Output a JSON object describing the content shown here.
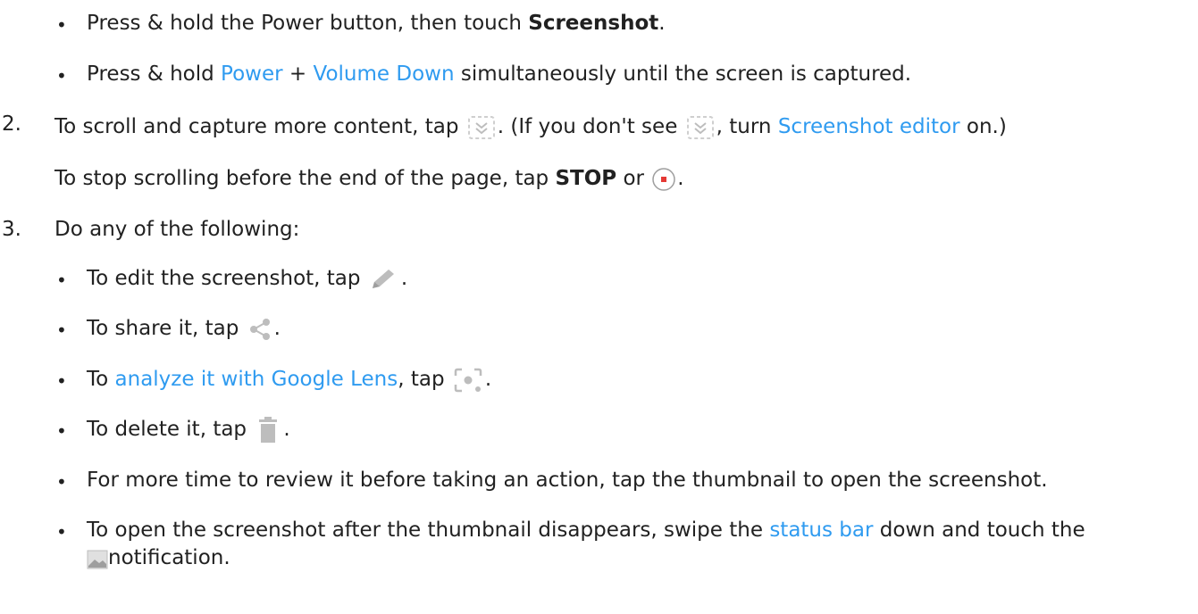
{
  "steps": {
    "bullet_power_menu": {
      "prefix": "Press & hold the Power button, then touch ",
      "bold": "Screenshot",
      "suffix": "."
    },
    "bullet_buttons": {
      "prefix": "Press & hold ",
      "link_power": "Power",
      "plus": " + ",
      "link_volume": "Volume Down",
      "suffix": " simultaneously until the screen is captured."
    },
    "step2": {
      "number": "2.",
      "part1": "To scroll and capture more content, tap ",
      "part2": ". (If you don't see ",
      "part3": ", turn ",
      "link_editor": "Screenshot editor",
      "part4": " on.)",
      "stop_prefix": "To stop scrolling before the end of the page, tap ",
      "stop_bold": "STOP",
      "stop_or": " or ",
      "stop_suffix": "."
    },
    "step3": {
      "number": "3.",
      "intro": "Do any of the following:",
      "edit_prefix": "To edit the screenshot, tap ",
      "edit_suffix": ".",
      "share_prefix": "To share it, tap ",
      "share_suffix": ".",
      "lens_prefix": "To ",
      "lens_link": "analyze it with Google Lens",
      "lens_mid": ", tap ",
      "lens_suffix": ".",
      "delete_prefix": "To delete it, tap ",
      "delete_suffix": ".",
      "review": "For more time to review it before taking an action, tap the thumbnail to open the screenshot.",
      "open_prefix": "To open the screenshot after the thumbnail disappears, swipe the ",
      "open_link": "status bar",
      "open_mid": " down and touch the",
      "open_suffix": "notification."
    }
  },
  "icons": {
    "scroll": "scroll-capture-icon",
    "stop": "stop-record-icon",
    "edit": "pencil-icon",
    "share": "share-icon",
    "lens": "google-lens-icon",
    "delete": "trash-icon",
    "image": "image-notification-icon"
  },
  "colors": {
    "text": "#212121",
    "link": "#2f9bf0",
    "icon_gray": "#bdbdbd",
    "stop_red": "#e53935"
  }
}
